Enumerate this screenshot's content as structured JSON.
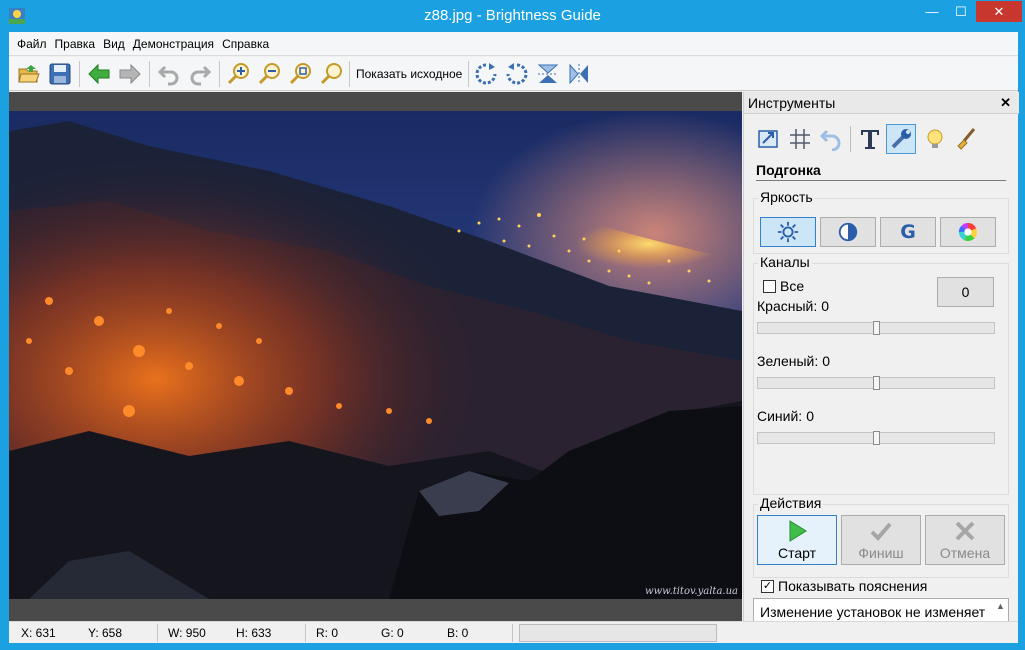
{
  "window": {
    "title": "z88.jpg - Brightness Guide",
    "min_glyph": "—",
    "max_glyph": "☐",
    "close_glyph": "✕"
  },
  "menu": [
    "Файл",
    "Правка",
    "Вид",
    "Демонстрация",
    "Справка"
  ],
  "toolbar": {
    "show_original_label": "Показать исходное",
    "icons": [
      "open-folder-icon",
      "save-icon",
      "back-arrow-icon",
      "forward-arrow-icon",
      "undo-icon",
      "redo-icon",
      "zoom-in-icon",
      "zoom-out-icon",
      "zoom-fit-icon",
      "zoom-actual-icon",
      "rotate-right-icon",
      "rotate-left-icon",
      "flip-vertical-icon",
      "flip-horizontal-icon"
    ]
  },
  "image": {
    "watermark": "www.titov.yalta.ua"
  },
  "panel": {
    "title": "Инструменты",
    "close_glyph": "✕",
    "tools": [
      "resize-icon",
      "crop-grid-icon",
      "undo-arrow-icon",
      "text-icon",
      "adjust-wrench-icon",
      "light-bulb-icon",
      "brush-icon"
    ],
    "active_tool": "adjust-wrench-icon",
    "section_title": "Подгонка",
    "brightness": {
      "label": "Яркость",
      "buttons": [
        "brightness-sun-icon",
        "contrast-icon",
        "gamma-icon",
        "color-wheel-icon"
      ],
      "gamma_letter": "G",
      "active": "brightness-sun-icon"
    },
    "channels": {
      "label": "Каналы",
      "all_label": "Все",
      "all_checked": false,
      "value_box": "0",
      "red_label": "Красный:",
      "red_value": "0",
      "red_level": 0.5,
      "green_label": "Зеленый:",
      "green_value": "0",
      "green_level": 0.5,
      "blue_label": "Синий:",
      "blue_value": "0",
      "blue_level": 0.5
    },
    "actions": {
      "label": "Действия",
      "start_label": "Старт",
      "finish_label": "Финиш",
      "cancel_label": "Отмена"
    },
    "hints": {
      "label": "Показывать пояснения",
      "checked": true,
      "text": "Изменение установок не изменяет изображение."
    }
  },
  "status": {
    "x": "X: 631",
    "y": "Y: 658",
    "w": "W: 950",
    "h": "H: 633",
    "r": "R: 0",
    "g": "G: 0",
    "b": "B: 0"
  },
  "colors": {
    "title_bar": "#1ba1e2",
    "close_button": "#c7372e",
    "accent": "#2f7fcb"
  }
}
